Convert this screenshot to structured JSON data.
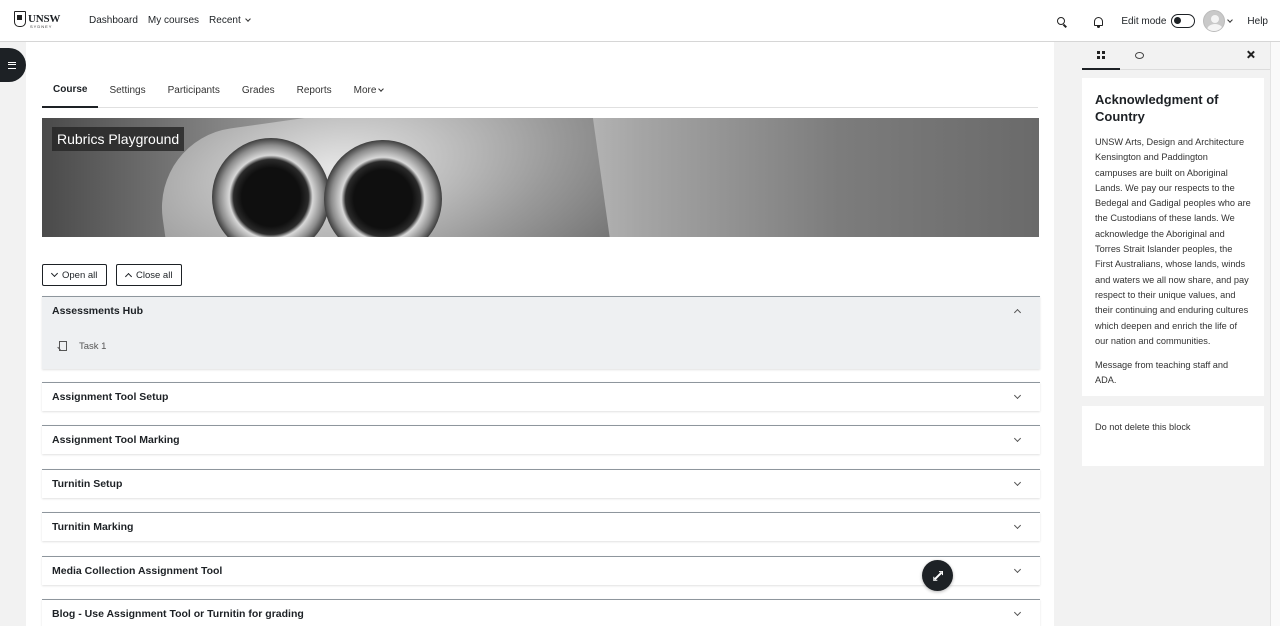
{
  "navbar": {
    "logo_text": "UNSW",
    "logo_sub": "SYDNEY",
    "links": [
      "Dashboard",
      "My courses",
      "Recent"
    ],
    "edit_mode_label": "Edit mode",
    "help_label": "Help"
  },
  "course": {
    "tabs": [
      "Course",
      "Settings",
      "Participants",
      "Grades",
      "Reports",
      "More"
    ],
    "active_tab": "Course",
    "title": "Rubrics Playground",
    "open_all": "Open all",
    "close_all": "Close all",
    "sections": [
      {
        "title": "Assessments Hub",
        "expanded": true,
        "activities": [
          "Task 1"
        ]
      },
      {
        "title": "Assignment Tool Setup",
        "expanded": false
      },
      {
        "title": "Assignment Tool Marking",
        "expanded": false
      },
      {
        "title": "Turnitin Setup",
        "expanded": false
      },
      {
        "title": "Turnitin Marking",
        "expanded": false
      },
      {
        "title": "Media Collection Assignment Tool",
        "expanded": false
      },
      {
        "title": "Blog - Use Assignment Tool or Turnitin for grading",
        "expanded": false
      }
    ]
  },
  "drawer": {
    "block1_title": "Acknowledgment of Country",
    "block1_p1": "UNSW Arts, Design and Architecture Kensington and Paddington campuses are built on Aboriginal Lands. We pay our respects to the Bedegal and Gadigal peoples who are the Custodians of these lands. We acknowledge the Aboriginal and Torres Strait Islander peoples, the First Australians, whose lands, winds and waters we all now share, and pay respect to their unique values, and their continuing and enduring cultures which deepen and enrich the life of our nation and communities.",
    "block1_p2": "Message from teaching staff and ADA.",
    "block2_text": "Do not delete this block"
  },
  "colors": {
    "accent": "#1d2125",
    "section_border": "#8e969d",
    "open_section_bg": "#eef0f2"
  }
}
